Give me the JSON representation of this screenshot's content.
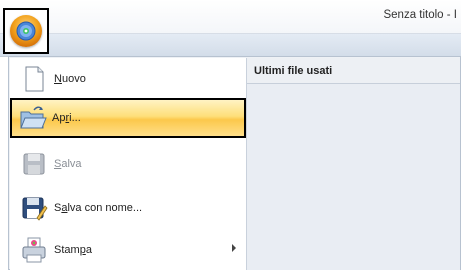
{
  "window": {
    "title": "Senza titolo - I"
  },
  "app_button": {
    "icon": "app-orb-icon"
  },
  "menu": {
    "items": [
      {
        "label_pre": "",
        "label_ul": "N",
        "label_post": "uovo",
        "icon": "new-document-icon",
        "state": "normal"
      },
      {
        "label_pre": "Ap",
        "label_ul": "r",
        "label_post": "i...",
        "icon": "open-folder-icon",
        "state": "selected"
      },
      {
        "label_pre": "",
        "label_ul": "S",
        "label_post": "alva",
        "icon": "save-disk-icon",
        "state": "disabled"
      },
      {
        "label_pre": "S",
        "label_ul": "a",
        "label_post": "lva con nome...",
        "icon": "save-as-icon",
        "state": "normal"
      },
      {
        "label_pre": "Stam",
        "label_ul": "p",
        "label_post": "a",
        "icon": "printer-icon",
        "state": "normal",
        "has_submenu": true
      }
    ]
  },
  "recent": {
    "title": "Ultimi file usati"
  }
}
